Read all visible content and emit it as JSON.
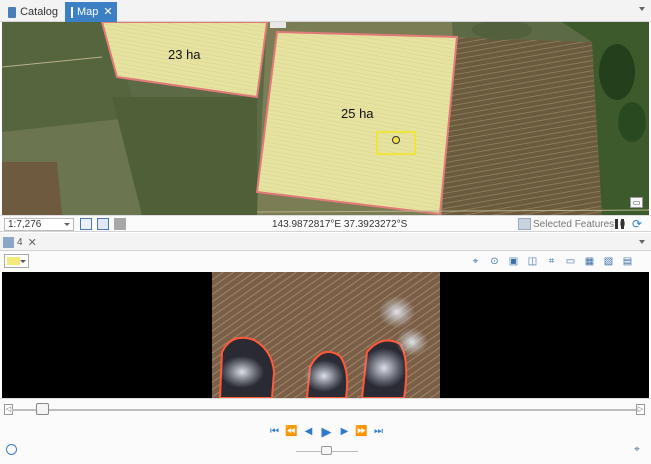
{
  "tabs": [
    {
      "label": "Catalog",
      "active": false,
      "icon": "catalog-icon"
    },
    {
      "label": "Map",
      "active": true,
      "icon": "map-icon"
    }
  ],
  "map": {
    "field_labels": [
      "23 ha",
      "25 ha"
    ],
    "colors": {
      "field_fill": "#e9e6a0",
      "field_outline": "#e27a7a",
      "selection_outline": "#f0e53a",
      "dark_vegetation": "#3f5f2e",
      "soil": "#6b5a3a"
    }
  },
  "status_bar": {
    "scale": "1:7,276",
    "coordinates": "143.9872817°E 37.3923272°S",
    "selected_features": "Selected Features: 0"
  },
  "video_panel": {
    "tab_label": "4",
    "swatch_color": "#f3ea7a"
  },
  "timeline": {
    "position_fraction": 0.05,
    "speed_fraction": 0.5
  }
}
